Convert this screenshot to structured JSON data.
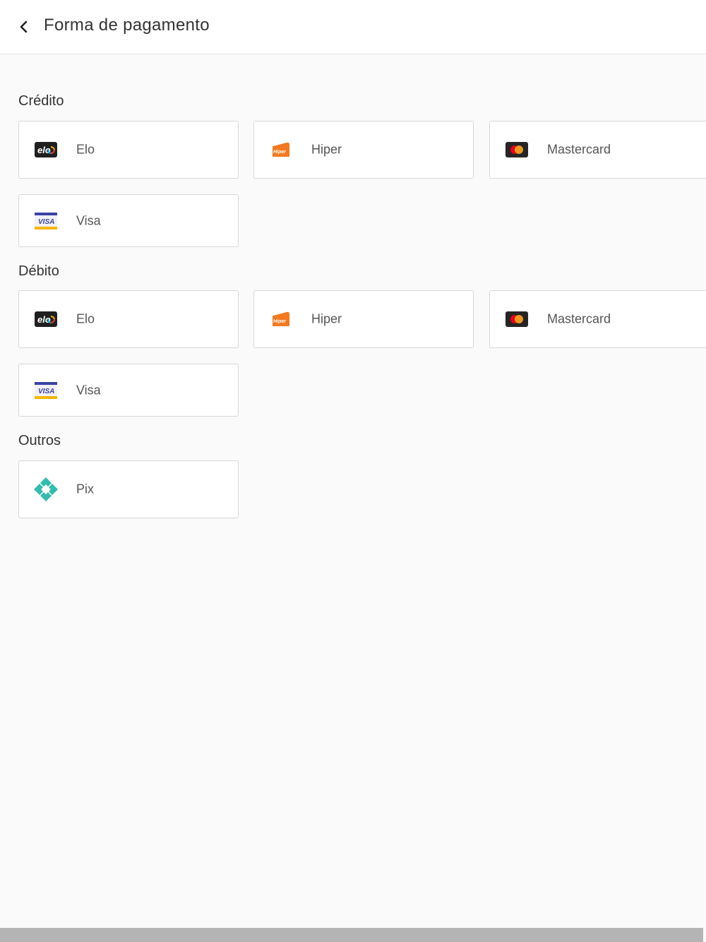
{
  "header": {
    "title": "Forma de pagamento"
  },
  "sections": {
    "credito": {
      "title": "Crédito",
      "elo": "Elo",
      "hiper": "Hiper",
      "mastercard": "Mastercard",
      "visa": "Visa"
    },
    "debito": {
      "title": "Débito",
      "elo": "Elo",
      "hiper": "Hiper",
      "mastercard": "Mastercard",
      "visa": "Visa"
    },
    "outros": {
      "title": "Outros",
      "pix": "Pix"
    }
  },
  "logo_text": {
    "elo": "elo",
    "hiper": "Hiper",
    "visa": "VISA"
  },
  "icons": {
    "back": "chevron-left-icon",
    "elo": "elo-logo-icon",
    "hiper": "hiper-logo-icon",
    "mastercard": "mastercard-logo-icon",
    "visa": "visa-logo-icon",
    "pix": "pix-logo-icon"
  },
  "colors": {
    "hiper": "#f47920",
    "mastercard_red": "#eb001b",
    "mastercard_orange": "#f79e1b",
    "visa_blue": "#3b43a6",
    "visa_gold": "#f7b600",
    "pix": "#32bcad",
    "elo_dark": "#1f1f1f"
  }
}
